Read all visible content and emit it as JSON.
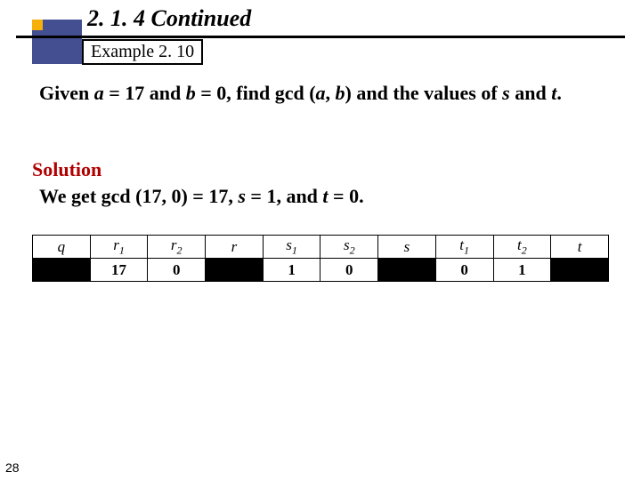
{
  "header": {
    "section": "2. 1. 4   Continued",
    "exampleLabel": "Example 2. 10"
  },
  "prompt": {
    "pre": "Given ",
    "a": "a",
    "eq1": " = 17 and ",
    "b": "b",
    "eq2": " = 0, find gcd (",
    "a2": "a",
    "comma": ", ",
    "b2": "b",
    "post": ") and the values of ",
    "s": "s",
    "and": " and ",
    "t": "t",
    "dot": "."
  },
  "solution": {
    "label": "Solution",
    "pre": "We get gcd (17, 0) = 17, ",
    "s": "s",
    "sval": " = 1, and ",
    "t": "t",
    "tval": " = 0."
  },
  "table": {
    "headers": {
      "q": "q",
      "r1a": "r",
      "r1b": "1",
      "r2a": "r",
      "r2b": "2",
      "r": "r",
      "s1a": "s",
      "s1b": "1",
      "s2a": "s",
      "s2b": "2",
      "s": "s",
      "t1a": "t",
      "t1b": "1",
      "t2a": "t",
      "t2b": "2",
      "t": "t"
    },
    "row": {
      "q": "",
      "r1": "17",
      "r2": "0",
      "r": "",
      "s1": "1",
      "s2": "0",
      "s": "",
      "t1": "0",
      "t2": "1",
      "t": ""
    }
  },
  "pageNum": "28"
}
